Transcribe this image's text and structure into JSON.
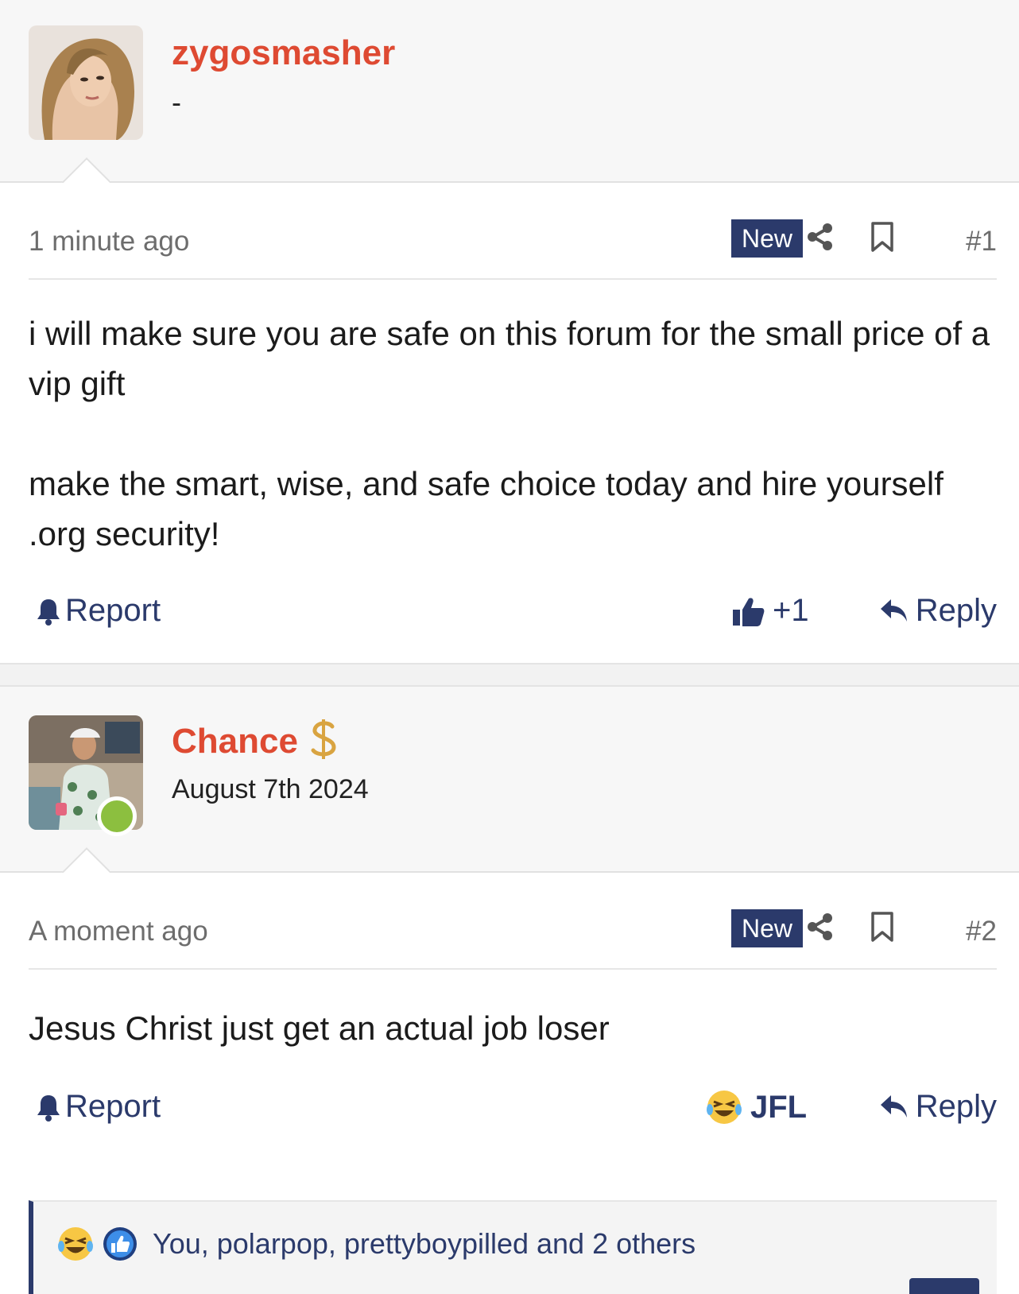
{
  "posts": [
    {
      "username": "zygosmasher",
      "subline": "-",
      "time": "1 minute ago",
      "badge": "New",
      "post_number": "#1",
      "body": [
        "i will make sure you are safe on this forum for the small price of a vip gift",
        "make the smart, wise, and safe choice today and hire yourself .org security!"
      ],
      "report_label": "Report",
      "reaction_label": "+1",
      "reply_label": "Reply"
    },
    {
      "username": "Chance",
      "user_badge_icon": "dollar-icon",
      "subline": "August 7th 2024",
      "time": "A moment ago",
      "badge": "New",
      "post_number": "#2",
      "body": [
        "Jesus Christ just get an actual job loser"
      ],
      "report_label": "Report",
      "reaction_label": "JFL",
      "reply_label": "Reply",
      "reactions_summary": "You, polarpop, prettyboypilled and 2 others"
    }
  ],
  "colors": {
    "username": "#de4a32",
    "accent": "#2b3a6b",
    "online": "#8cbf3f",
    "muted": "#6d6d6d"
  }
}
